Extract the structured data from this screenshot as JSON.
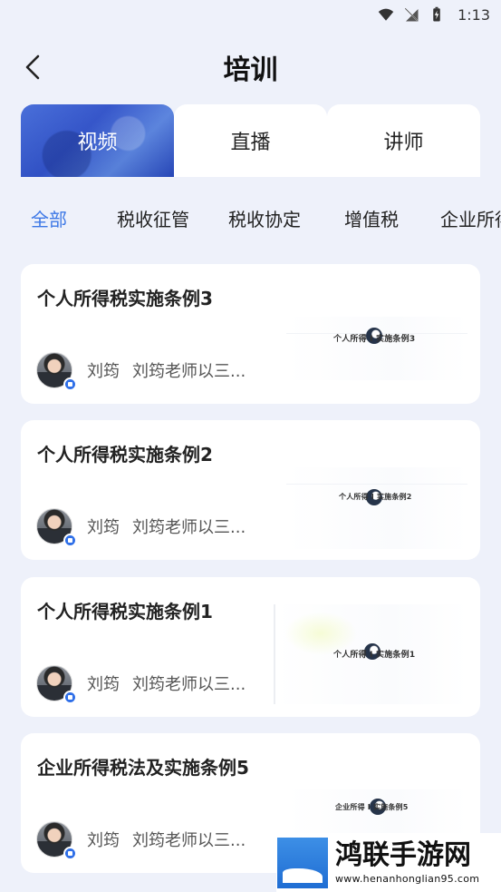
{
  "status_bar": {
    "time": "1:13",
    "icons": [
      "wifi-icon",
      "signal-off-icon",
      "battery-icon"
    ]
  },
  "header": {
    "title": "培训",
    "back_icon": "chevron-left-icon"
  },
  "tabs": [
    {
      "label": "视频",
      "active": true
    },
    {
      "label": "直播",
      "active": false
    },
    {
      "label": "讲师",
      "active": false
    }
  ],
  "categories": [
    {
      "label": "全部",
      "active": true
    },
    {
      "label": "税收征管",
      "active": false
    },
    {
      "label": "税收协定",
      "active": false
    },
    {
      "label": "增值税",
      "active": false
    },
    {
      "label": "企业所得",
      "active": false
    }
  ],
  "colors": {
    "accent": "#3d78e6",
    "tab_active": "#2c4fcc",
    "background": "#eef1fa"
  },
  "cards": [
    {
      "title": "个人所得税实施条例3",
      "author": "刘筠",
      "desc": "刘筠老师以三...",
      "thumb_text": "个人所得 I 实施条例3"
    },
    {
      "title": "个人所得税实施条例2",
      "author": "刘筠",
      "desc": "刘筠老师以三...",
      "thumb_text": "个人所得 I 实施条例2"
    },
    {
      "title": "个人所得税实施条例1",
      "author": "刘筠",
      "desc": "刘筠老师以三...",
      "thumb_text": "个人所得 I 实施条例1"
    },
    {
      "title": "企业所得税法及实施条例5",
      "author": "刘筠",
      "desc": "刘筠老师以三...",
      "thumb_text": "企业所得 I 实施条例5"
    }
  ],
  "watermark": {
    "title": "鸿联手游网",
    "url": "www.henanhonglian95.com"
  }
}
